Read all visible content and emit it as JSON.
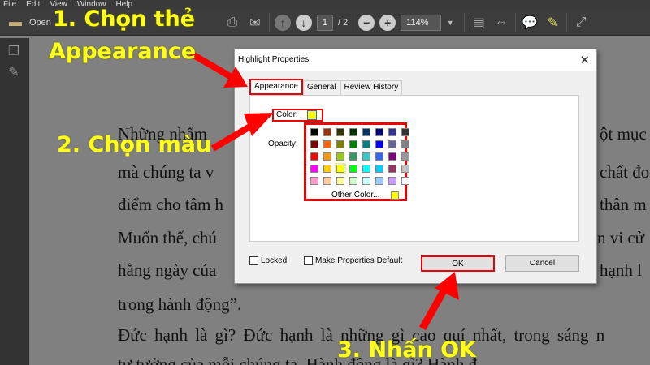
{
  "menu": [
    "File",
    "Edit",
    "View",
    "Window",
    "Help"
  ],
  "toolbar": {
    "open_label": "Open",
    "page_current": "1",
    "page_total": "/ 2",
    "zoom": "114%"
  },
  "document": {
    "left_lines": [
      "Những nhẩm",
      "mà chúng ta v",
      "điểm cho tâm h",
      "Muốn thế, chú",
      "hằng ngày của",
      "trong hành động”.",
      "Đức hạnh là gì? Đức hạnh là những gì cao quí nhất, trong sáng n"
    ],
    "right_lines": [
      "ột mục",
      "chất đo",
      "thân m",
      "n vi cử",
      "hạnh l"
    ],
    "bottom_line": "tư tưởng của mỗi chúng ta. Hành động là gì? Hành đ"
  },
  "dialog": {
    "title": "Highlight Properties",
    "tabs": [
      "Appearance",
      "General",
      "Review History"
    ],
    "color_label": "Color:",
    "opacity_label": "Opacity:",
    "other_color": "Other Color...",
    "locked": "Locked",
    "make_default": "Make Properties Default",
    "ok": "OK",
    "cancel": "Cancel",
    "selected_color": "#FFFF00",
    "palette": [
      [
        "#000000",
        "#993300",
        "#333300",
        "#003300",
        "#003366",
        "#000080",
        "#333399",
        "#333333"
      ],
      [
        "#800000",
        "#FF6600",
        "#808000",
        "#008000",
        "#008080",
        "#0000FF",
        "#666699",
        "#808080"
      ],
      [
        "#FF0000",
        "#FF9900",
        "#99CC00",
        "#339966",
        "#33CCCC",
        "#3366FF",
        "#800080",
        "#999999"
      ],
      [
        "#FF00FF",
        "#FFCC00",
        "#FFFF00",
        "#00FF00",
        "#00FFFF",
        "#00CCFF",
        "#993366",
        "#C0C0C0"
      ],
      [
        "#FF99CC",
        "#FFCC99",
        "#FFFF99",
        "#CCFFCC",
        "#CCFFFF",
        "#99CCFF",
        "#CC99FF",
        "#FFFFFF"
      ]
    ]
  },
  "annotations": {
    "step1_line1": "1. Chọn thẻ",
    "step1_line2": "Appearance",
    "step2": "2. Chọn màu",
    "step3": "3. Nhấn OK"
  }
}
